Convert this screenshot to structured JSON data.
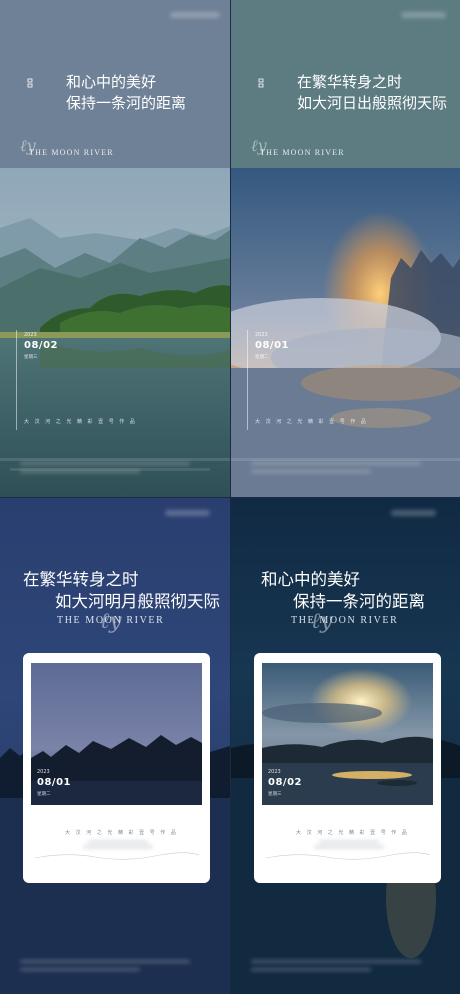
{
  "posters": [
    {
      "heading": [
        "和心中的美好",
        "保持一条河的距离"
      ],
      "brand": "THE MOON RIVER",
      "date": {
        "year": "2023",
        "day": "08/02",
        "weekday": "星期三"
      },
      "tagline": "大 汶 河 之 光   精 彩 壹 号 作 品",
      "colors": {
        "sky": "#6f8196",
        "water": "#3d5a63"
      }
    },
    {
      "heading": [
        "在繁华转身之时",
        "如大河日出般照彻天际"
      ],
      "brand": "THE MOON RIVER",
      "date": {
        "year": "2023",
        "day": "08/01",
        "weekday": "星期二"
      },
      "tagline": "大 汶 河 之 光   精 彩 壹 号 作 品",
      "colors": {
        "sky": "#5c7c82",
        "sunrise": "#f0a24a"
      }
    },
    {
      "heading": [
        "在繁华转身之时",
        "如大河明月般照彻天际"
      ],
      "brand": "THE MOON RIVER",
      "date": {
        "year": "2023",
        "day": "08/01",
        "weekday": "星期二"
      },
      "tagline": "大 汶 河 之 光   精 彩 壹 号 作 品",
      "colors": {
        "background": "#2a3f70",
        "card": "#ffffff"
      }
    },
    {
      "heading": [
        "和心中的美好",
        "保持一条河的距离"
      ],
      "brand": "THE MOON RIVER",
      "date": {
        "year": "2023",
        "day": "08/02",
        "weekday": "星期三"
      },
      "tagline": "大 汶 河 之 光   精 彩 壹 号 作 品",
      "colors": {
        "background": "#112a44",
        "card": "#ffffff"
      }
    }
  ],
  "icons": {
    "quote": "closing-quote-icon",
    "marker": "small-logo-icon",
    "moon": "crescent-moon-icon"
  }
}
